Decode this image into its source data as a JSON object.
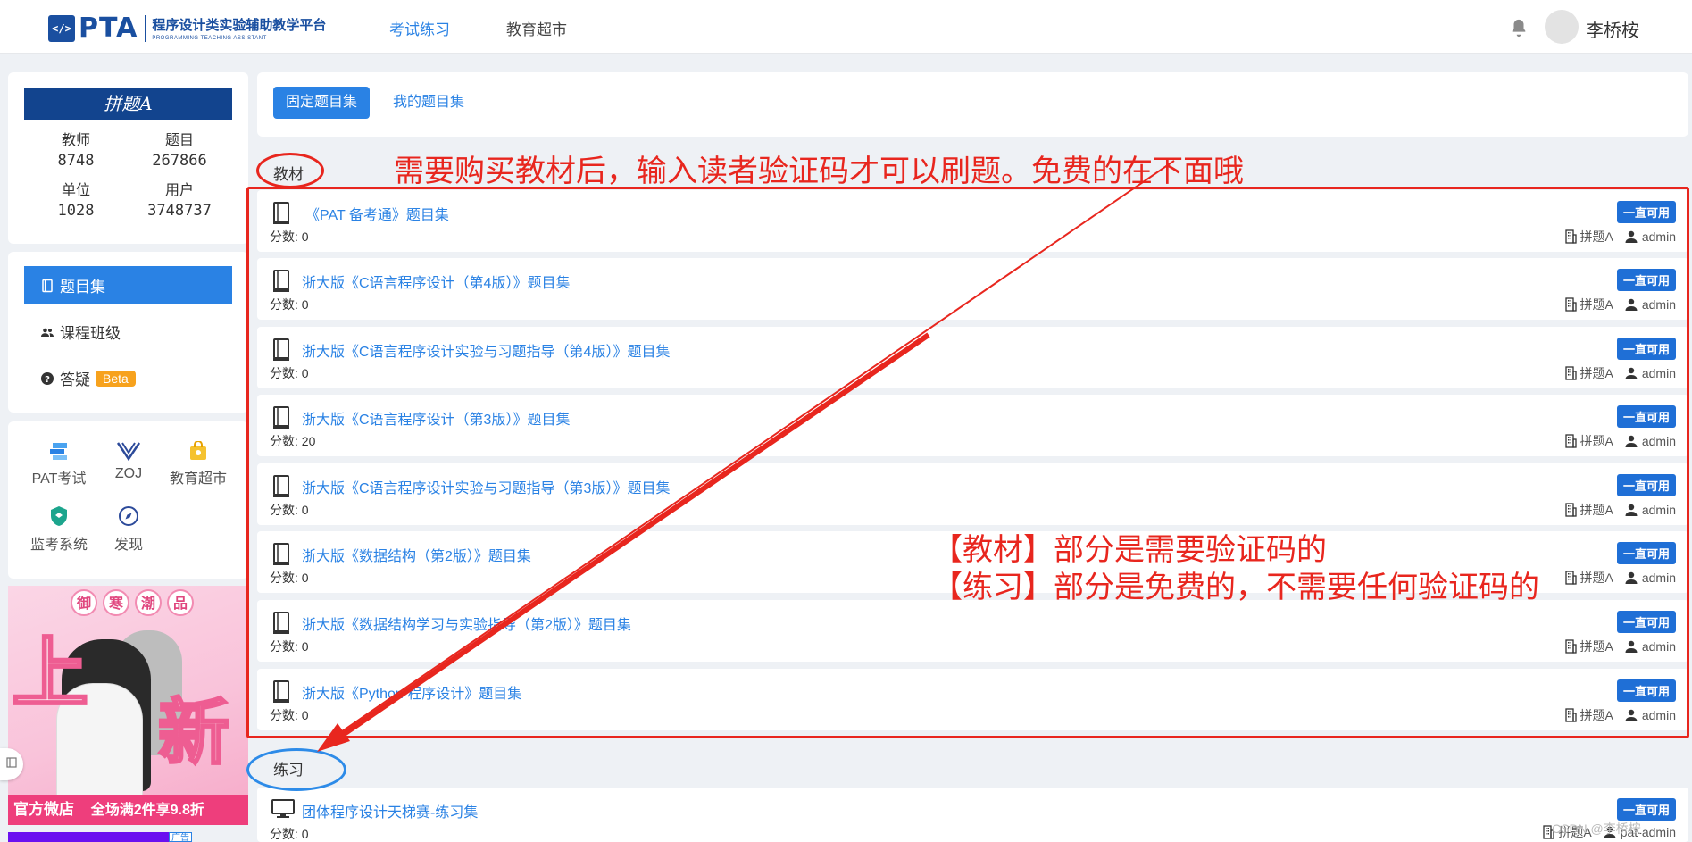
{
  "header": {
    "logo_mark": "</>",
    "logo_text": "PTA",
    "logo_cn": "程序设计类实验辅助教学平台",
    "logo_en": "PROGRAMMING TEACHING ASSISTANT",
    "nav": [
      "考试练习",
      "教育超市"
    ],
    "username": "李桥桉"
  },
  "sidebar": {
    "banner": "拼题A",
    "stats": [
      {
        "label": "教师",
        "value": "8748"
      },
      {
        "label": "题目",
        "value": "267866"
      },
      {
        "label": "单位",
        "value": "1028"
      },
      {
        "label": "用户",
        "value": "3748737"
      }
    ],
    "menu": [
      {
        "label": "题目集"
      },
      {
        "label": "课程班级"
      },
      {
        "label": "答疑",
        "badge": "Beta"
      }
    ],
    "apps": [
      {
        "label": "PAT考试"
      },
      {
        "label": "ZOJ"
      },
      {
        "label": "教育超市"
      },
      {
        "label": "监考系统"
      },
      {
        "label": "发现"
      }
    ],
    "ad": {
      "top": [
        "御",
        "寒",
        "潮",
        "品"
      ],
      "big1": "上",
      "big2": "新",
      "foot_left": "官方微店",
      "foot_right": "全场满2件享9.8折",
      "label": "广告"
    }
  },
  "tabs": [
    "固定题目集",
    "我的题目集"
  ],
  "sections": {
    "textbook": "教材",
    "practice": "练习"
  },
  "problem_sets": [
    {
      "title": "《PAT 备考通》题目集",
      "score": "分数: 0",
      "badge": "一直可用",
      "org": "拼题A",
      "owner": "admin"
    },
    {
      "title": "浙大版《C语言程序设计（第4版）》题目集",
      "score": "分数: 0",
      "badge": "一直可用",
      "org": "拼题A",
      "owner": "admin"
    },
    {
      "title": "浙大版《C语言程序设计实验与习题指导（第4版）》题目集",
      "score": "分数: 0",
      "badge": "一直可用",
      "org": "拼题A",
      "owner": "admin"
    },
    {
      "title": "浙大版《C语言程序设计（第3版）》题目集",
      "score": "分数: 20",
      "badge": "一直可用",
      "org": "拼题A",
      "owner": "admin"
    },
    {
      "title": "浙大版《C语言程序设计实验与习题指导（第3版）》题目集",
      "score": "分数: 0",
      "badge": "一直可用",
      "org": "拼题A",
      "owner": "admin"
    },
    {
      "title": "浙大版《数据结构（第2版）》题目集",
      "score": "分数: 0",
      "badge": "一直可用",
      "org": "拼题A",
      "owner": "admin"
    },
    {
      "title": "浙大版《数据结构学习与实验指导（第2版）》题目集",
      "score": "分数: 0",
      "badge": "一直可用",
      "org": "拼题A",
      "owner": "admin"
    },
    {
      "title": "浙大版《Python 程序设计》题目集",
      "score": "分数: 0",
      "badge": "一直可用",
      "org": "拼题A",
      "owner": "admin"
    }
  ],
  "practice_sets": [
    {
      "title": "团体程序设计天梯赛-练习集",
      "score": "分数: 0",
      "badge": "一直可用",
      "org": "拼题A",
      "owner": "pat-admin"
    }
  ],
  "annotations": {
    "top": "需要购买教材后，输入读者验证码才可以刷题。免费的在下面哦",
    "line1": "【教材】部分是需要验证码的",
    "line2": "【练习】部分是免费的，不需要任何验证码的",
    "watermark": "CSDN @李桥桉"
  },
  "colors": {
    "primary": "#2a82e4",
    "badge": "#1f6fd6",
    "annotation": "#e8261e",
    "banner": "#12448e"
  }
}
